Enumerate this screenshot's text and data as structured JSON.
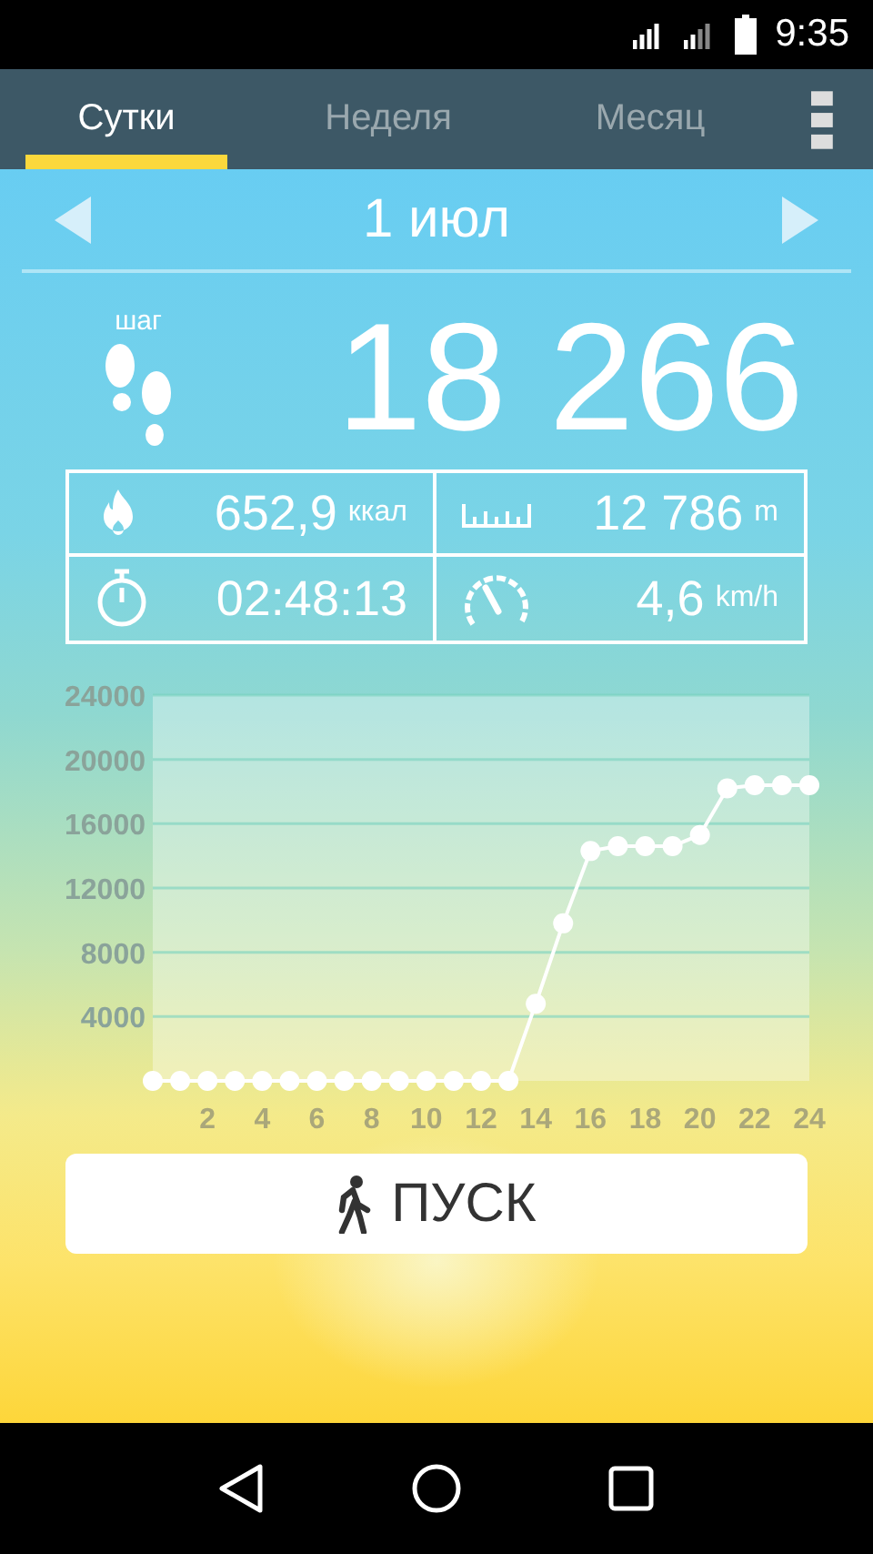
{
  "status_bar": {
    "time": "9:35"
  },
  "tabs": [
    {
      "label": "Сутки",
      "selected": true
    },
    {
      "label": "Неделя",
      "selected": false
    },
    {
      "label": "Месяц",
      "selected": false
    }
  ],
  "date": "1 июл",
  "steps": {
    "label": "шаг",
    "value": "18 266"
  },
  "stats": [
    {
      "kind": "calories",
      "value": "652,9",
      "unit": "ккал"
    },
    {
      "kind": "distance",
      "value": "12 786",
      "unit": "m"
    },
    {
      "kind": "time",
      "value": "02:48:13"
    },
    {
      "kind": "speed",
      "value": "4,6",
      "unit": "km/h"
    }
  ],
  "chart_data": {
    "type": "line",
    "x": [
      0,
      1,
      2,
      3,
      4,
      5,
      6,
      7,
      8,
      9,
      10,
      11,
      12,
      13,
      14,
      15,
      16,
      17,
      18,
      19,
      20,
      21,
      22,
      23,
      24
    ],
    "grid": true,
    "series": [
      {
        "color": "#ffffff",
        "marker": "circle",
        "values": [
          0,
          0,
          0,
          0,
          0,
          0,
          0,
          0,
          0,
          0,
          0,
          0,
          0,
          0,
          4800,
          9800,
          14300,
          14600,
          14600,
          14600,
          15300,
          18200,
          18400,
          18400,
          18400
        ]
      }
    ],
    "xlim": [
      0,
      24
    ],
    "ylim": [
      0,
      24000
    ],
    "xticks": [
      2,
      4,
      6,
      8,
      10,
      12,
      14,
      16,
      18,
      20,
      22,
      24
    ],
    "yticks": [
      4000,
      8000,
      12000,
      16000,
      20000,
      24000
    ]
  },
  "start_button": "ПУСК"
}
